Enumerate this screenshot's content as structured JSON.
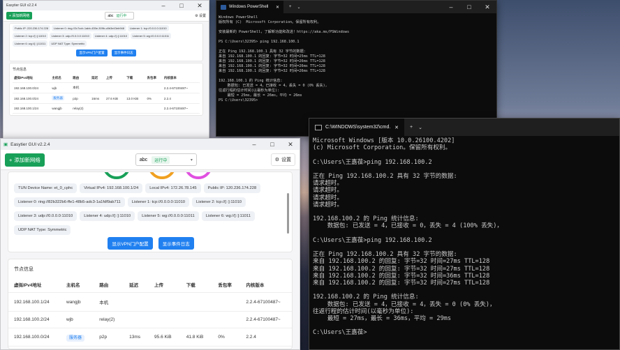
{
  "back_window": {
    "title": "Easytier GUI v2.2.4",
    "add_label": "+ 添加新网络",
    "network_name": "abc",
    "status": "运行中",
    "settings_label": "⚙ 设置",
    "tags": [
      "Public IP: 220.236.174.228",
      "Listener 0: ring://2c7ccb-1abb-435e-309b-c8b3e43eb948",
      "Listener 1: tcp://0.0.0.0:11010",
      "Listener 2: tcp://[::]:11010",
      "Listener 3: udp://0.0.0.0:11010",
      "Listener 4: udp://[::]:11010",
      "Listener 5: wg://0.0.0.0:11011",
      "Listener 6: wg://[::]:11011",
      "UDP NAT Type: Symmetric"
    ],
    "actions": [
      "显示VPN门户配置",
      "显示事件日志"
    ],
    "section_title": "节点信息",
    "headers": [
      "虚拟IPv4地址",
      "主机名",
      "路由",
      "延迟",
      "上传",
      "下载",
      "丢包率",
      "内核版本"
    ],
    "rows": [
      [
        "192.168.100.0/24",
        "wjb",
        "本机",
        "",
        "",
        "",
        "",
        "2.2.4-67100487~"
      ],
      [
        "192.168.100.0/24",
        "服务器",
        "p2p",
        "16ms",
        "27.6 KiB",
        "13.0 KiB",
        "0%",
        "2.2.4"
      ],
      [
        "192.168.100.1/24",
        "wangjb",
        "relay(2)",
        "",
        "",
        "",
        "",
        "2.2.4-67100487~"
      ]
    ]
  },
  "powershell": {
    "tab_title": "Windows PowerShell",
    "lines": [
      "Windows PowerShell",
      "版权所有 (C)  Microsoft Corporation。保留所有权利。",
      "",
      "安装最新的 PowerShell，了解新功能和改进！https://aka.ms/PSWindows",
      "",
      "PS C:\\Users\\32395> ping 192.168.100.1",
      "",
      "正在 Ping 192.168.100.1 具有 32 字节的数据:",
      "来自 192.168.100.1 的回复: 字节=32 时间=25ms TTL=128",
      "来自 192.168.100.1 的回复: 字节=32 时间=26ms TTL=128",
      "来自 192.168.100.1 的回复: 字节=32 时间=26ms TTL=128",
      "来自 192.168.100.1 的回复: 字节=32 时间=26ms TTL=128",
      "",
      "192.168.100.1 的 Ping 统计信息:",
      "    数据包: 已发送 = 4，已接收 = 4，丢失 = 0 (0% 丢失)，",
      "往返行程的估计时间(以毫秒为单位):",
      "    最短 = 25ms，最长 = 26ms，平均 = 26ms",
      "PS C:\\Users\\32395>"
    ]
  },
  "main_window": {
    "title": "Easytier GUI v2.2.4",
    "add_label": "添加新网络",
    "network_name": "abc",
    "status": "运行中",
    "settings_label": "设置",
    "tags": [
      "TUN Device Name: et_0_cphc",
      "Virtual IPv4: 192.168.100.1/24",
      "Local IPv4: 172.26.78.145",
      "Public IP: 120.236.174.228",
      "Listener 0: ring://82b322b6-ffe1-48b5-adc3-1a1fdf9ab711",
      "Listener 1: tcp://0.0.0.0:11010",
      "Listener 2: tcp://[::]:11010",
      "Listener 3: udp://0.0.0.0:11010",
      "Listener 4: udp://[::]:11010",
      "Listener 5: wg://0.0.0.0:11011",
      "Listener 6: wg://[::]:11011",
      "UDP NAT Type: Symmetric"
    ],
    "actions": [
      "显示VPN门户配置",
      "显示事件日志"
    ],
    "section_title": "节点信息",
    "headers": [
      "虚拟IPv4地址",
      "主机名",
      "路由",
      "延迟",
      "上传",
      "下载",
      "丢包率",
      "内核版本"
    ],
    "rows": [
      [
        "192.168.100.1/24",
        "wangjb",
        "本机",
        "",
        "",
        "",
        "",
        "2.2.4-67100487~"
      ],
      [
        "192.168.100.2/24",
        "wjb",
        "relay(2)",
        "",
        "",
        "",
        "",
        "2.2.4-67100487~"
      ],
      [
        "192.168.100.0/24",
        "服务器",
        "p2p",
        "13ms",
        "95.6 KiB",
        "41.8 KiB",
        "0%",
        "2.2.4"
      ]
    ],
    "ring_colors": [
      "#18a058",
      "#f0a020",
      "#e050e0"
    ]
  },
  "cmd": {
    "tab_title": "C:\\WINDOWS\\system32\\cmd.",
    "lines": [
      "Microsoft Windows [版本 10.0.26100.4202]",
      "(c) Microsoft Corporation。保留所有权利。",
      "",
      "C:\\Users\\王嘉葆>ping 192.168.100.2",
      "",
      "正在 Ping 192.168.100.2 具有 32 字节的数据:",
      "请求超时。",
      "请求超时。",
      "请求超时。",
      "请求超时。",
      "",
      "192.168.100.2 的 Ping 统计信息:",
      "    数据包: 已发送 = 4，已接收 = 0，丢失 = 4 (100% 丢失)，",
      "",
      "C:\\Users\\王嘉葆>ping 192.168.100.2",
      "",
      "正在 Ping 192.168.100.2 具有 32 字节的数据:",
      "来自 192.168.100.2 的回复: 字节=32 时间=27ms TTL=128",
      "来自 192.168.100.2 的回复: 字节=32 时间=27ms TTL=128",
      "来自 192.168.100.2 的回复: 字节=32 时间=36ms TTL=128",
      "来自 192.168.100.2 的回复: 字节=32 时间=27ms TTL=128",
      "",
      "192.168.100.2 的 Ping 统计信息:",
      "    数据包: 已发送 = 4，已接收 = 4，丢失 = 0 (0% 丢失)，",
      "往返行程的估计时间(以毫秒为单位):",
      "    最短 = 27ms，最长 = 36ms，平均 = 29ms",
      "",
      "C:\\Users\\王嘉葆>"
    ]
  }
}
